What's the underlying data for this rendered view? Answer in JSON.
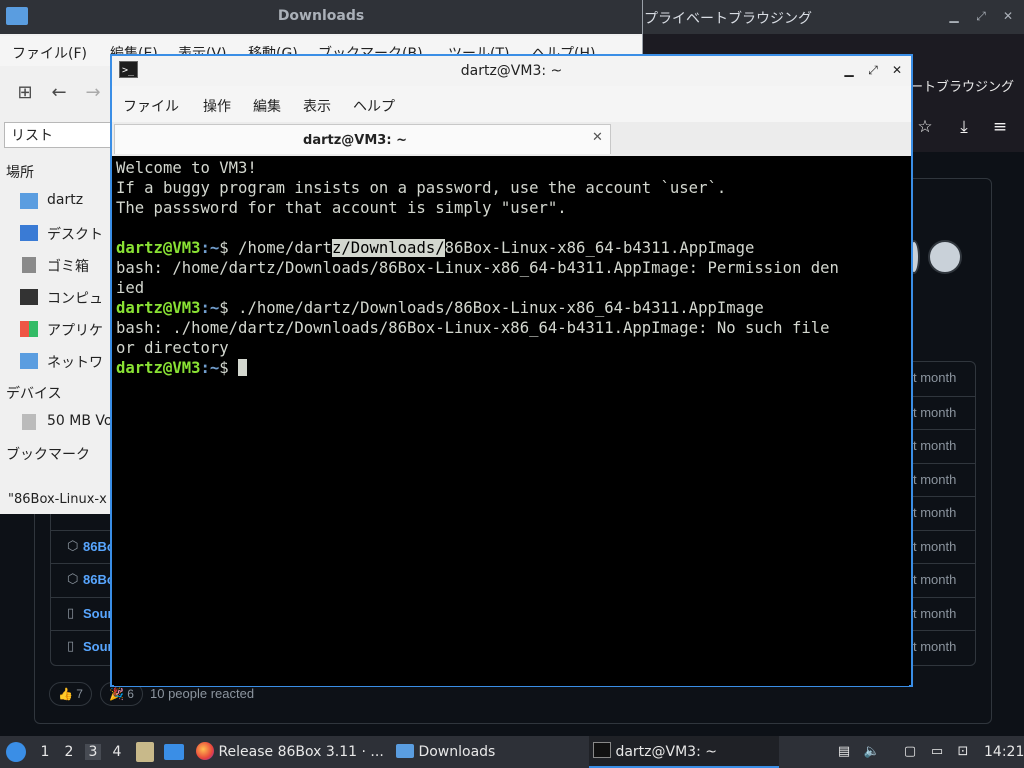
{
  "browser": {
    "title": "プライベートブラウジング",
    "private_label": "ートブラウジング",
    "assets": [
      {
        "name": "",
        "time": "t month"
      },
      {
        "name": "",
        "time": "t month"
      },
      {
        "name": "",
        "time": "t month"
      },
      {
        "name": "",
        "time": "t month"
      },
      {
        "name": "",
        "time": "t month"
      },
      {
        "name": "86Bo",
        "time": "t month"
      },
      {
        "name": "86Bo",
        "time": "t month"
      },
      {
        "name": "Sour",
        "time": "t month"
      },
      {
        "name": "Sour",
        "time": "t month"
      }
    ],
    "reactions": [
      {
        "emoji": "👍",
        "count": "7"
      },
      {
        "emoji": "🎉",
        "count": "6"
      }
    ],
    "reacted_text": "10 people reacted"
  },
  "file_manager": {
    "title": "Downloads",
    "menu": [
      "ファイル(F)",
      "編集(E)",
      "表示(V)",
      "移動(G)",
      "ブックマーク(B)",
      "ツール(T)",
      "ヘルプ(H)"
    ],
    "view_mode": "リスト",
    "places_header": "場所",
    "places": [
      "dartz",
      "デスクト",
      "ゴミ箱",
      "コンピュ",
      "アプリケ",
      "ネットワ"
    ],
    "devices_header": "デバイス",
    "devices": [
      "50 MB Vo"
    ],
    "bookmarks_header": "ブックマーク",
    "status": "\"86Box-Linux-x"
  },
  "terminal": {
    "title": "dartz@VM3: ~",
    "menu": [
      "ファイル",
      "操作",
      "編集",
      "表示",
      "ヘルプ"
    ],
    "tab_title": "dartz@VM3: ~",
    "lines": {
      "l1": "Welcome to VM3!",
      "l2": "If a buggy program insists on a password, use the account `user`.",
      "l3": "The passsword for that account is simply \"user\".",
      "prompt_user": "dartz@VM3",
      "prompt_path": ":~",
      "prompt_sym": "$ ",
      "cmd1_a": "/home/dart",
      "cmd1_sel": "z/Downloads/",
      "cmd1_b": "86Box-Linux-x86_64-b4311.AppImage",
      "err1a": "bash: /home/dartz/Downloads/86Box-Linux-x86_64-b4311.AppImage: Permission den",
      "err1b": "ied",
      "cmd2": "./home/dartz/Downloads/86Box-Linux-x86_64-b4311.AppImage",
      "err2a": "bash: ./home/dartz/Downloads/86Box-Linux-x86_64-b4311.AppImage: No such file",
      "err2b": "or directory"
    }
  },
  "taskbar": {
    "workspaces": [
      "1",
      "2",
      "3",
      "4"
    ],
    "active_workspace": "3",
    "tasks": [
      {
        "label": "Release 86Box 3.11 · ...",
        "icon": "firefox-icon"
      },
      {
        "label": "Downloads",
        "icon": "folder-icon"
      },
      {
        "label": "dartz@VM3: ~",
        "icon": "terminal-icon"
      }
    ],
    "clock": "14:21"
  },
  "colors": {
    "terminal_user": "#8ae234",
    "terminal_path": "#729fcf",
    "accent": "#3a8ee6"
  }
}
